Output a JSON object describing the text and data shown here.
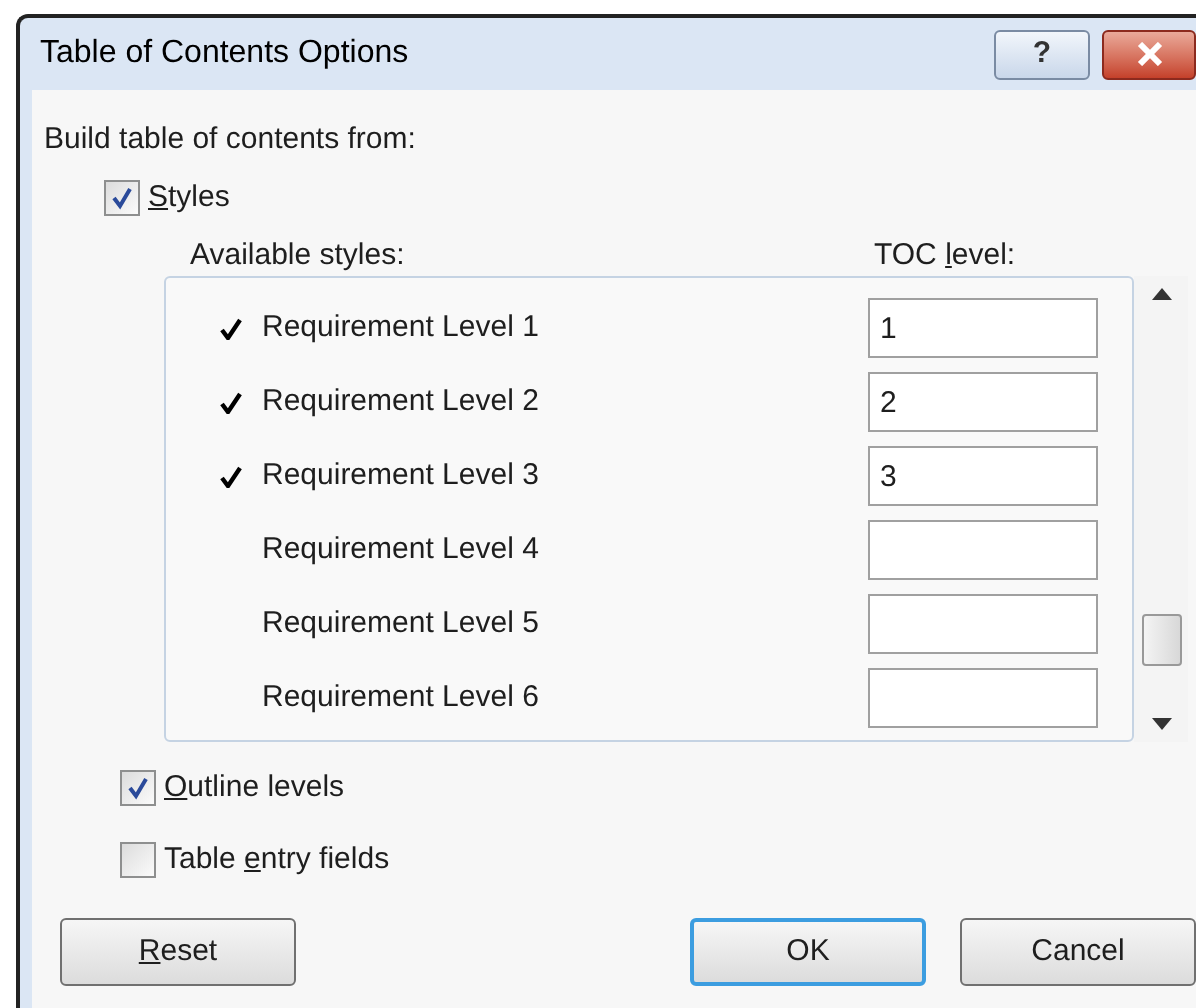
{
  "window": {
    "title": "Table of Contents Options",
    "title_buttons": [
      {
        "kind": "help",
        "label": "?"
      },
      {
        "kind": "close"
      }
    ]
  },
  "section_label": "Build table of contents from:",
  "styles_option": {
    "label": {
      "key": "S",
      "after": "tyles"
    },
    "checked": true
  },
  "columns": {
    "available_styles": "Available styles:",
    "toc_level": {
      "before": "TOC ",
      "key": "l",
      "after": "evel:"
    }
  },
  "styles": [
    {
      "name": "Requirement Level 1",
      "checked": true,
      "toc_level": "1"
    },
    {
      "name": "Requirement Level 2",
      "checked": true,
      "toc_level": "2"
    },
    {
      "name": "Requirement Level 3",
      "checked": true,
      "toc_level": "3"
    },
    {
      "name": "Requirement Level 4",
      "checked": false
    },
    {
      "name": "Requirement Level 5",
      "checked": false
    },
    {
      "name": "Requirement Level 6",
      "checked": false
    }
  ],
  "options": [
    {
      "label": {
        "key": "O",
        "after": "utline levels"
      },
      "checked": true
    },
    {
      "label": {
        "before": "Table ",
        "key": "e",
        "after": "ntry fields"
      },
      "checked": false
    }
  ],
  "buttons": [
    {
      "label": {
        "key": "R",
        "after": "eset"
      },
      "default": false
    },
    {
      "label": {
        "before": "OK"
      },
      "default": true
    },
    {
      "label": {
        "before": "Cancel"
      },
      "default": false
    }
  ]
}
